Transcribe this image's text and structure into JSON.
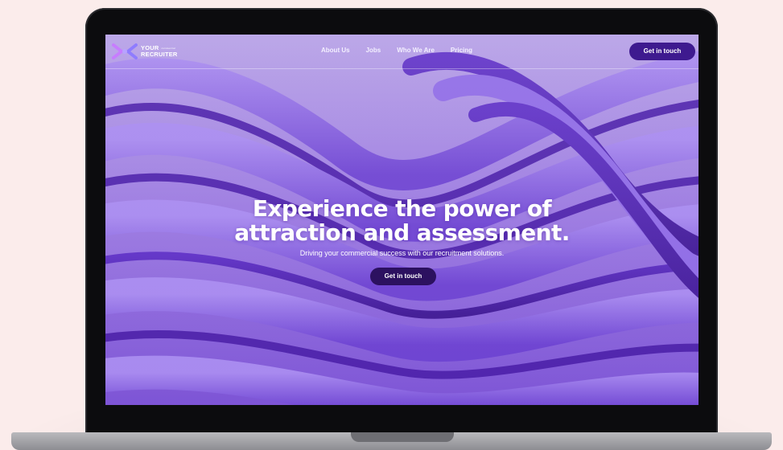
{
  "logo": {
    "line1": "YOUR",
    "line2": "RECRUITER",
    "tag": "commercial",
    "icon": "yr-logo-icon"
  },
  "nav": {
    "links": [
      "About Us",
      "Jobs",
      "Who We Are",
      "Pricing"
    ],
    "cta_label": "Get in touch"
  },
  "hero": {
    "title_line1": "Experience the power of",
    "title_line2": "attraction and assessment.",
    "subtitle": "Driving your commercial success with our recruitment solutions.",
    "cta_label": "Get in touch"
  },
  "colors": {
    "background": "#fbeceb",
    "accent": "#3e1a8f",
    "hero_purple": "#8a66d8"
  }
}
